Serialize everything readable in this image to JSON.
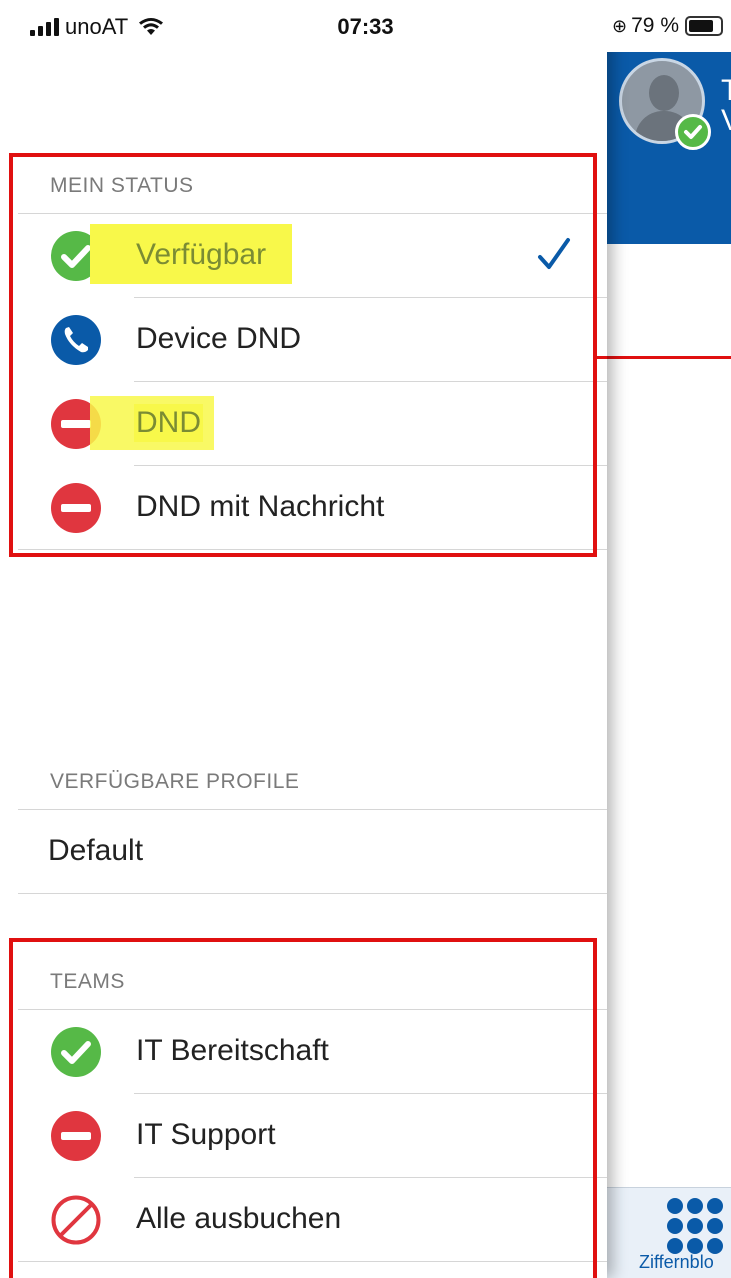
{
  "status_bar": {
    "carrier": "unoAT",
    "time": "07:33",
    "battery": "79 %"
  },
  "drawer": {
    "status_section": {
      "header": "MEIN STATUS",
      "items": [
        {
          "label": "Verfügbar",
          "icon": "check-circle-green-icon",
          "selected": true,
          "highlighted": true
        },
        {
          "label": "Device DND",
          "icon": "phone-circle-blue-icon",
          "selected": false,
          "highlighted": false
        },
        {
          "label": "DND",
          "icon": "minus-circle-red-icon",
          "selected": false,
          "highlighted": true
        },
        {
          "label": "DND mit Nachricht",
          "icon": "minus-circle-red-icon",
          "selected": false,
          "highlighted": false
        }
      ]
    },
    "profiles_section": {
      "header": "VERFÜGBARE PROFILE",
      "items": [
        {
          "label": "Default"
        }
      ]
    },
    "teams_section": {
      "header": "TEAMS",
      "items": [
        {
          "label": "IT Bereitschaft",
          "icon": "check-circle-green-icon"
        },
        {
          "label": "IT Support",
          "icon": "minus-circle-red-icon"
        },
        {
          "label": "Alle ausbuchen",
          "icon": "prohibited-icon"
        }
      ]
    }
  },
  "app_panel": {
    "header_text_line1": "T",
    "header_text_line2": "V",
    "tab_label": "Ziffernblo"
  },
  "colors": {
    "brand_blue": "#0a5aa8",
    "status_green": "#56b947",
    "status_red": "#e0363f",
    "annotation_red": "#e01010",
    "highlight_yellow": "#f8f84a"
  }
}
